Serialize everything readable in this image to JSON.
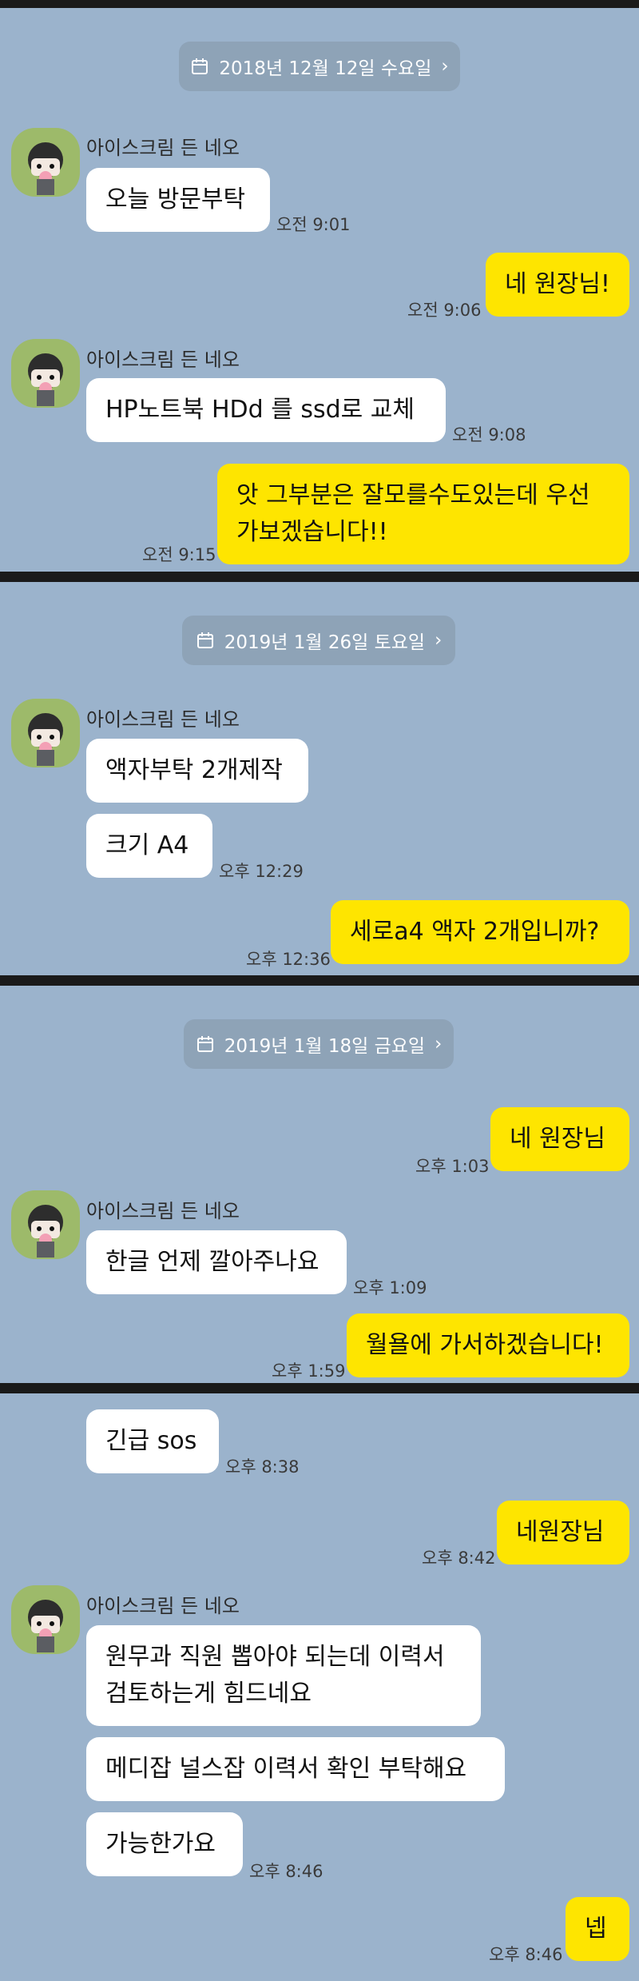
{
  "sender_name": "아이스크림 든 네오",
  "colors": {
    "chat_bg": "#9bb3cc",
    "incoming_bubble": "#ffffff",
    "outgoing_bubble": "#fee500",
    "date_pill": "#8ea3b7",
    "divider": "#1a1a1a"
  },
  "icons": {
    "calendar": "calendar-icon",
    "chevron": "chevron-right-icon",
    "avatar": "neo-character-avatar"
  },
  "panels": [
    {
      "date": "2018년 12월 12일 수요일",
      "messages": [
        {
          "text": "오늘 방문부탁",
          "time": "오전 9:01"
        },
        {
          "text": "네 원장님!",
          "time": "오전 9:06"
        },
        {
          "text": "HP노트북 HDd 를 ssd로 교체",
          "time": "오전 9:08"
        },
        {
          "text": "앗 그부분은 잘모를수도있는데 우선\n가보겠습니다!!",
          "time": "오전 9:15"
        }
      ]
    },
    {
      "date": "2019년 1월 26일 토요일",
      "messages": [
        {
          "text": "액자부탁 2개제작"
        },
        {
          "text": "크기 A4",
          "time": "오후 12:29"
        },
        {
          "text": "세로a4 액자 2개입니까?",
          "time": "오후 12:36"
        }
      ]
    },
    {
      "date": "2019년 1월 18일 금요일",
      "messages": [
        {
          "text": "네 원장님",
          "time": "오후 1:03"
        },
        {
          "text": "한글 언제 깔아주나요",
          "time": "오후 1:09"
        },
        {
          "text": "월욜에 가서하겠습니다!",
          "time": "오후 1:59"
        }
      ]
    },
    {
      "messages": [
        {
          "text": "긴급 sos",
          "time": "오후 8:38"
        },
        {
          "text": "네원장님",
          "time": "오후 8:42"
        },
        {
          "text": "원무과 직원 뽑아야 되는데 이력서\n검토하는게  힘드네요"
        },
        {
          "text": "메디잡 널스잡  이력서 확인 부탁해요"
        },
        {
          "text": "가능한가요",
          "time": "오후 8:46"
        },
        {
          "text": "넵",
          "time": "오후 8:46"
        }
      ]
    }
  ]
}
